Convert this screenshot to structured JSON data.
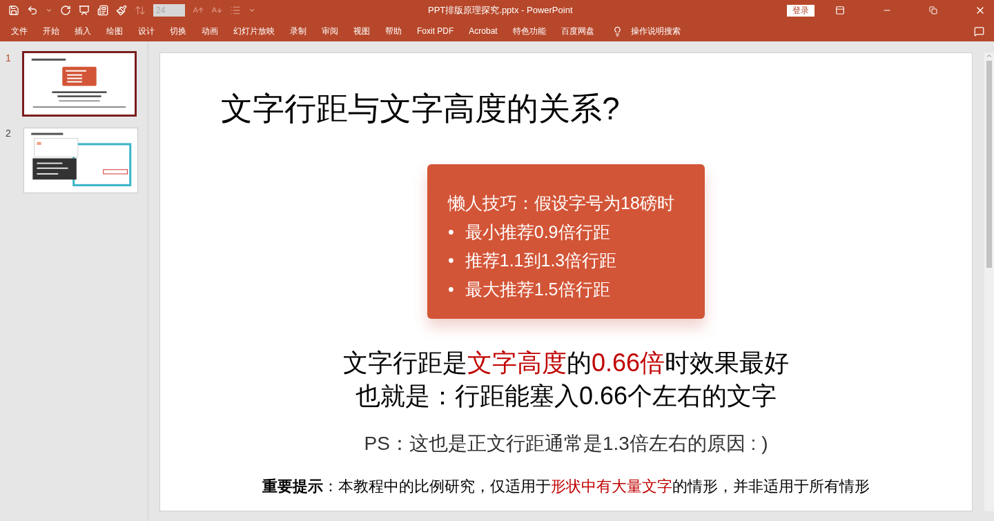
{
  "quick_access": [
    {
      "kind": "save",
      "disabled": false
    },
    {
      "kind": "undo",
      "disabled": false
    },
    {
      "kind": "undo-menu",
      "disabled": false
    },
    {
      "kind": "redo",
      "disabled": false
    },
    {
      "kind": "present",
      "disabled": false
    },
    {
      "kind": "textbox",
      "disabled": false
    },
    {
      "kind": "painter",
      "disabled": false
    },
    {
      "kind": "line-spacing",
      "disabled": true
    },
    {
      "kind": "font-size",
      "value": "24",
      "disabled": true
    },
    {
      "kind": "grow-font",
      "disabled": true
    },
    {
      "kind": "shrink-font",
      "disabled": true
    },
    {
      "kind": "bullets",
      "disabled": true
    },
    {
      "kind": "customize",
      "disabled": false
    }
  ],
  "window": {
    "title": "PPT排版原理探究.pptx  -  PowerPoint",
    "sign_in": "登录"
  },
  "ribbon_tabs": [
    "文件",
    "开始",
    "插入",
    "绘图",
    "设计",
    "切换",
    "动画",
    "幻灯片放映",
    "录制",
    "审阅",
    "视图",
    "帮助",
    "Foxit PDF",
    "Acrobat",
    "特色功能",
    "百度网盘"
  ],
  "tell_me": "操作说明搜索",
  "slides_panel": [
    {
      "number": "1",
      "selected": true,
      "kind": "title-card"
    },
    {
      "number": "2",
      "selected": false,
      "kind": "dialog-screenshot"
    }
  ],
  "slide": {
    "title": "文字行距与文字高度的关系?",
    "card": {
      "heading": "懒人技巧：假设字号为18磅时",
      "bullets": [
        {
          "mark": "•",
          "text": "最小推荐0.9倍行距"
        },
        {
          "mark": "•",
          "text": "推荐1.1到1.3倍行距"
        },
        {
          "mark": "•",
          "text": "最大推荐1.5倍行距"
        }
      ]
    },
    "lines": [
      {
        "kind": "statement",
        "segments": [
          {
            "kind": "plain",
            "text": "文字行距是"
          },
          {
            "kind": "accent",
            "text": "文字高度"
          },
          {
            "kind": "plain",
            "text": "的"
          },
          {
            "kind": "accent",
            "text": "0.66倍"
          },
          {
            "kind": "plain",
            "text": "时效果最好"
          }
        ]
      },
      {
        "kind": "statement",
        "segments": [
          {
            "kind": "plain",
            "text": "也就是：行距能塞入0.66个左右的文字"
          }
        ]
      },
      {
        "kind": "note",
        "segments": [
          {
            "kind": "plain",
            "text": "PS：这也是正文行距通常是1.3倍左右的原因 : )"
          }
        ]
      },
      {
        "kind": "tip",
        "segments": [
          {
            "kind": "bold",
            "text": "重要提示"
          },
          {
            "kind": "plain",
            "text": "：本教程中的比例研究，仅适用于"
          },
          {
            "kind": "accent",
            "text": "形状中有大量文字"
          },
          {
            "kind": "plain",
            "text": "的情形，并非适用于所有情形"
          }
        ]
      }
    ]
  }
}
